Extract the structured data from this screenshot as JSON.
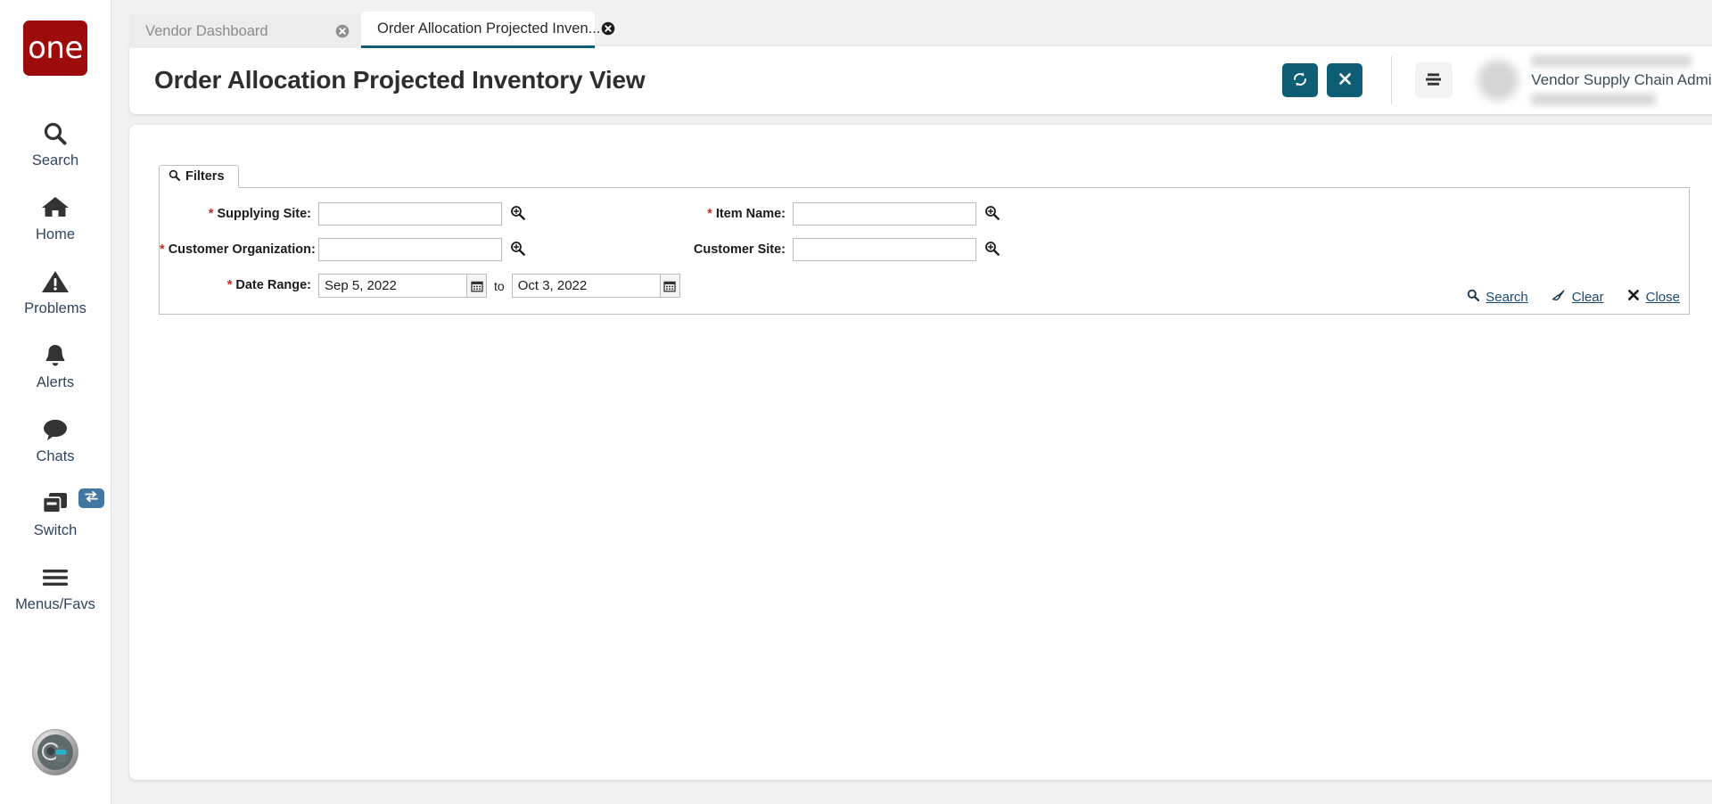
{
  "brand": {
    "logo_text": "one",
    "logo_color": "#9e0b0b",
    "accent_teal": "#0d5e75",
    "link_color": "#1a4b6e",
    "required_color": "#c22b2b"
  },
  "rail": {
    "items": [
      {
        "label": "Search",
        "icon": "search-icon"
      },
      {
        "label": "Home",
        "icon": "home-icon"
      },
      {
        "label": "Problems",
        "icon": "warning-triangle-icon"
      },
      {
        "label": "Alerts",
        "icon": "bell-icon"
      },
      {
        "label": "Chats",
        "icon": "chat-bubble-icon"
      },
      {
        "label": "Switch",
        "icon": "switch-windows-icon",
        "badge_icon": "exchange-arrows-icon"
      },
      {
        "label": "Menus/Favs",
        "icon": "hamburger-icon"
      }
    ],
    "avatar_icon": "user-avatar-icon"
  },
  "tabs": [
    {
      "label": "Vendor Dashboard",
      "active": false,
      "close_icon": "close-circle-icon"
    },
    {
      "label": "Order Allocation Projected Inven...",
      "active": true,
      "close_icon": "close-circle-icon"
    }
  ],
  "header": {
    "title": "Order Allocation Projected Inventory View",
    "refresh_icon": "refresh-icon",
    "close_icon": "close-x-icon",
    "menu_icon": "list-menu-icon",
    "user_role": "Vendor Supply Chain Admin",
    "caret_icon": "chevron-down-icon"
  },
  "filters": {
    "tab_label": "Filters",
    "tab_icon": "search-icon",
    "fields": {
      "supplying_site": {
        "label": "Supplying Site:",
        "required": true,
        "value": "",
        "placeholder": "",
        "lookup_icon": "magnifier-plus-icon"
      },
      "item_name": {
        "label": "Item Name:",
        "required": true,
        "value": "",
        "placeholder": "",
        "lookup_icon": "magnifier-plus-icon"
      },
      "customer_organization": {
        "label": "Customer Organization:",
        "required": true,
        "value": "",
        "placeholder": "",
        "lookup_icon": "magnifier-plus-icon"
      },
      "customer_site": {
        "label": "Customer Site:",
        "required": false,
        "value": "",
        "placeholder": "",
        "lookup_icon": "magnifier-plus-icon"
      },
      "date_range": {
        "label": "Date Range:",
        "required": true,
        "from_value": "Sep 5, 2022",
        "to_value": "Oct 3, 2022",
        "separator": "to",
        "calendar_icon": "calendar-icon"
      }
    },
    "actions": [
      {
        "label": "Search",
        "icon": "search-icon"
      },
      {
        "label": "Clear",
        "icon": "eraser-icon"
      },
      {
        "label": "Close",
        "icon": "close-x-icon"
      }
    ]
  }
}
